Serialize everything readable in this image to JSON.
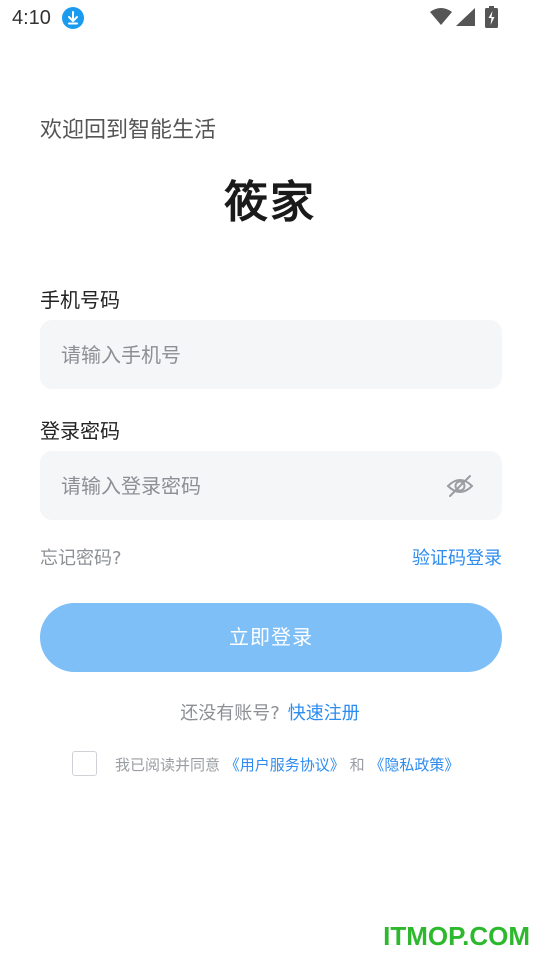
{
  "status_bar": {
    "time": "4:10"
  },
  "header": {
    "welcome": "欢迎回到智能生活",
    "app_title": "筱家"
  },
  "form": {
    "phone_label": "手机号码",
    "phone_placeholder": "请输入手机号",
    "phone_value": "",
    "password_label": "登录密码",
    "password_placeholder": "请输入登录密码",
    "password_value": "",
    "forgot_password": "忘记密码?",
    "sms_login": "验证码登录",
    "login_button": "立即登录"
  },
  "register": {
    "prompt": "还没有账号?",
    "link": "快速注册"
  },
  "agreement": {
    "prefix": "我已阅读并同意",
    "user_agreement": "《用户服务协议》",
    "and": "和",
    "privacy_policy": "《隐私政策》",
    "checked": false
  },
  "watermark": "ITMOP.COM",
  "colors": {
    "accent": "#2d8cf0",
    "button": "#7fbff8",
    "input_bg": "#f5f6f8",
    "watermark": "#2db82d"
  },
  "icons": {
    "status_download": "download-icon",
    "wifi": "wifi-icon",
    "signal": "signal-icon",
    "battery": "battery-icon",
    "password_visibility": "eye-off-icon"
  }
}
